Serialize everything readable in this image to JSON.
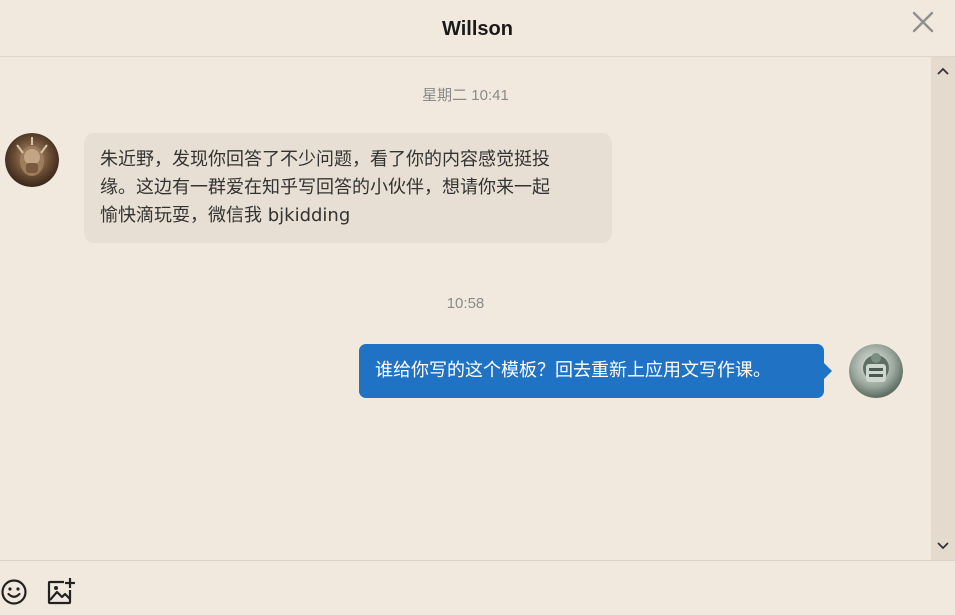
{
  "header": {
    "title": "Willson"
  },
  "messages": [
    {
      "timestamp": "星期二 10:41",
      "direction": "incoming",
      "lines": [
        "朱近野，发现你回答了不少问题，看了你的内容感觉挺投",
        "缘。这边有一群爱在知乎写回答的小伙伴，想请你来一起",
        "愉快滴玩耍，微信我 bjkidding"
      ]
    },
    {
      "timestamp": "10:58",
      "direction": "outgoing",
      "text": "谁给你写的这个模板？回去重新上应用文写作课。"
    }
  ],
  "icons": {
    "close": "close-icon",
    "scroll_up": "chevron-up-icon",
    "scroll_down": "chevron-down-icon",
    "emoji": "smiley-icon",
    "image": "add-image-icon"
  },
  "colors": {
    "background": "#f1e9de",
    "incoming_bubble": "#e7dfd3",
    "outgoing_bubble": "#1f72c4",
    "outgoing_text": "#ffffff"
  }
}
